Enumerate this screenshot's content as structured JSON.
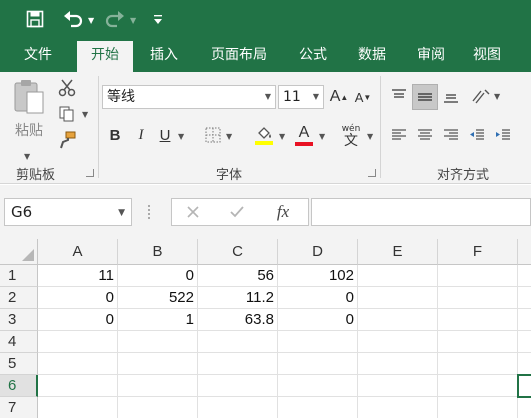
{
  "qat": {
    "save_icon": "save-icon",
    "undo_icon": "undo-icon",
    "redo_icon": "redo-icon",
    "customize_icon": "customize-qat-icon"
  },
  "tabs": [
    "文件",
    "开始",
    "插入",
    "页面布局",
    "公式",
    "数据",
    "审阅",
    "视图"
  ],
  "active_tab": "开始",
  "ribbon": {
    "clipboard": {
      "paste_label": "粘贴",
      "group_label": "剪贴板"
    },
    "font": {
      "font_name": "等线",
      "font_size": "11",
      "bold": "B",
      "italic": "I",
      "underline": "U",
      "font_color_letter": "A",
      "wen_top": "wén",
      "wen_bottom": "文",
      "grow_letter": "A",
      "shrink_letter": "A",
      "group_label": "字体",
      "highlight_color": "#ffff00",
      "font_color": "#e81123"
    },
    "alignment": {
      "group_label": "对齐方式"
    }
  },
  "formula_bar": {
    "name_box": "G6",
    "fx_label": "fx",
    "formula": ""
  },
  "sheet": {
    "columns": [
      "A",
      "B",
      "C",
      "D",
      "E",
      "F"
    ],
    "rows": [
      "1",
      "2",
      "3",
      "4",
      "5",
      "6",
      "7"
    ],
    "cells": [
      [
        "11",
        "0",
        "56",
        "102",
        "",
        ""
      ],
      [
        "0",
        "522",
        "11.2",
        "0",
        "",
        ""
      ],
      [
        "0",
        "1",
        "63.8",
        "0",
        "",
        ""
      ],
      [
        "",
        "",
        "",
        "",
        "",
        ""
      ],
      [
        "",
        "",
        "",
        "",
        "",
        ""
      ],
      [
        "",
        "",
        "",
        "",
        "",
        ""
      ],
      [
        "",
        "",
        "",
        "",
        "",
        ""
      ]
    ],
    "active_row": "6",
    "accent": "#217346"
  }
}
